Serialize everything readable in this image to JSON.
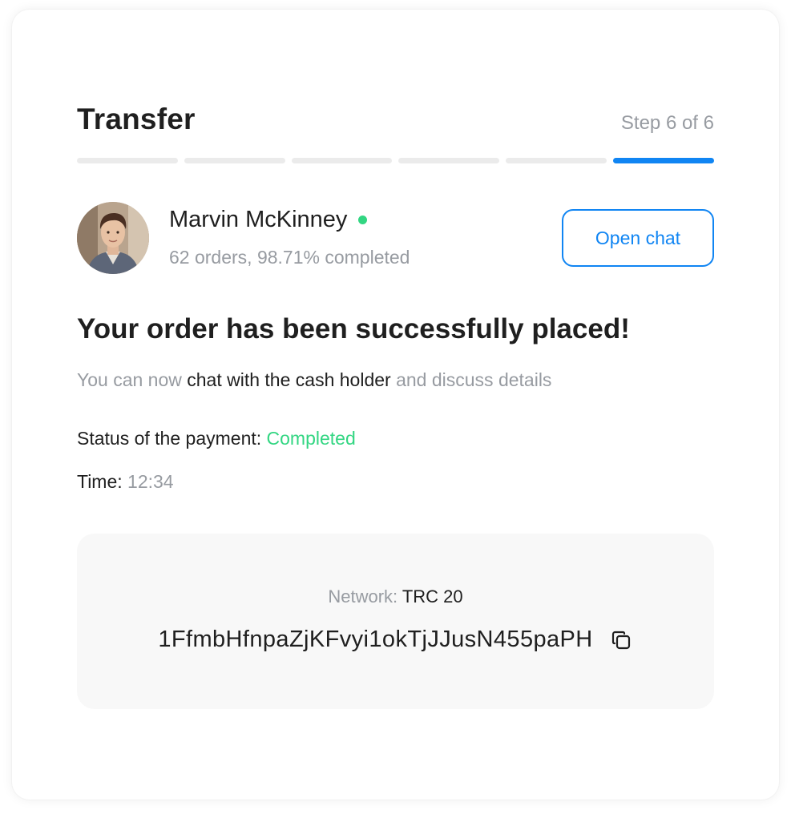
{
  "header": {
    "title": "Transfer",
    "step_text": "Step 6 of 6",
    "steps_total": 6,
    "steps_current": 6
  },
  "user": {
    "name": "Marvin McKinney",
    "status": "online",
    "stats": "62 orders, 98.71% completed",
    "open_chat_label": "Open chat"
  },
  "order": {
    "headline": "Your order has been successfully placed!",
    "sub_prefix": "You can now ",
    "sub_highlight": "chat with the cash holder",
    "sub_suffix": " and discuss details",
    "status_label": "Status of the payment: ",
    "status_value": "Completed",
    "time_label": "Time: ",
    "time_value": "12:34"
  },
  "network": {
    "label": "Network: ",
    "value": "TRC 20",
    "address": "1FfmbHfnpaZjKFvyi1okTjJJusN455paPH",
    "copy_icon": "copy-icon"
  },
  "colors": {
    "accent": "#1085f3",
    "success": "#32d682",
    "muted": "#979ba1",
    "text": "#1f1f1f",
    "track": "#ebebeb",
    "panel": "#f8f8f8"
  }
}
